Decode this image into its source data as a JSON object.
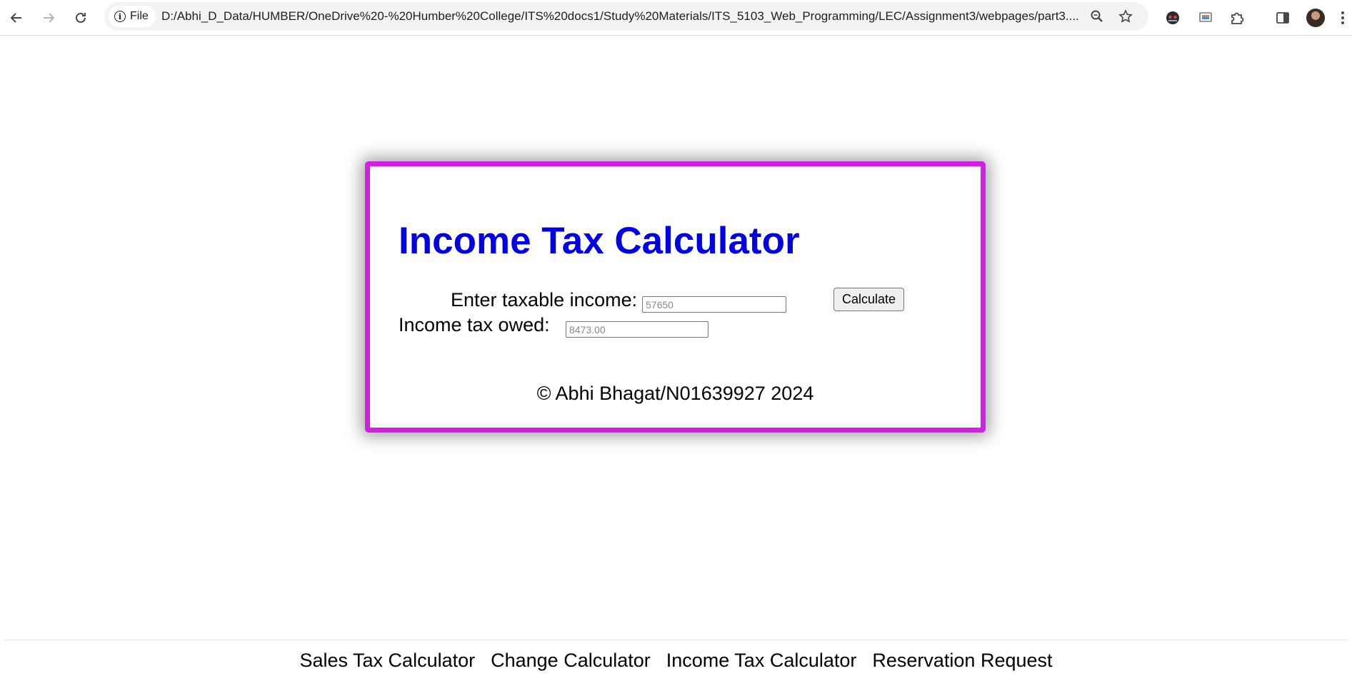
{
  "browser": {
    "site_chip_label": "File",
    "url": "D:/Abhi_D_Data/HUMBER/OneDrive%20-%20Humber%20College/ITS%20docs1/Study%20Materials/ITS_5103_Web_Programming/LEC/Assignment3/webpages/part3....",
    "icons": [
      "back-arrow-icon",
      "forward-arrow-icon",
      "reload-icon",
      "info-icon",
      "zoom-icon",
      "star-icon",
      "extension-icon",
      "cast-icon",
      "puzzle-icon",
      "side-panel-icon",
      "avatar",
      "more-menu-icon"
    ]
  },
  "calculator": {
    "title": "Income Tax Calculator",
    "income_label": "Enter taxable income:",
    "income_placeholder": "57650",
    "owed_label": "Income tax owed:",
    "owed_placeholder": "8473.00",
    "button_label": "Calculate",
    "credit": "© Abhi Bhagat/N01639927 2024"
  },
  "nav": {
    "items": [
      {
        "label": "Sales Tax Calculator"
      },
      {
        "label": "Change Calculator"
      },
      {
        "label": "Income Tax Calculator"
      },
      {
        "label": "Reservation Request"
      }
    ]
  },
  "colors": {
    "title": "#0000e6",
    "card_border": "#d51ee5"
  }
}
